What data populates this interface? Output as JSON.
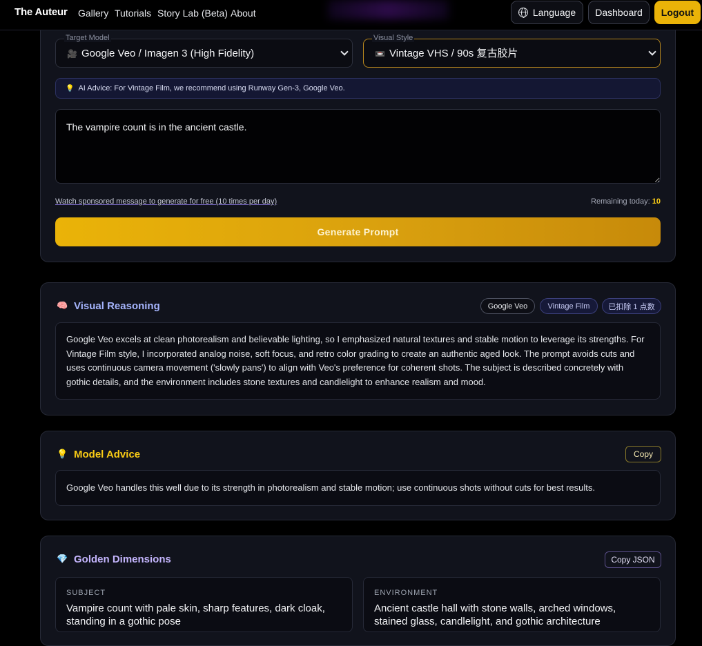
{
  "nav": {
    "brand": "The Auteur",
    "links": [
      "Gallery",
      "Tutorials",
      "Story Lab (Beta)",
      "About"
    ],
    "language_label": "Language",
    "dashboard_label": "Dashboard",
    "logout_label": "Logout"
  },
  "generator": {
    "target_model": {
      "legend": "Target Model",
      "icon": "🎥",
      "selected": "Google Veo / Imagen 3 (High Fidelity)"
    },
    "visual_style": {
      "legend": "Visual Style",
      "icon": "📼",
      "selected": "Vintage VHS / 90s 复古胶片"
    },
    "ai_advice": "AI Advice: For Vintage Film, we recommend using Runway Gen-3, Google Veo.",
    "prompt_text": "The vampire count is in the ancient castle.",
    "sponsored_link": "Watch sponsored message to generate for free (10 times per day)",
    "remaining_label": "Remaining today:",
    "remaining_value": "10",
    "generate_label": "Generate Prompt"
  },
  "visual_reasoning": {
    "icon": "🧠",
    "title": "Visual Reasoning",
    "tags": [
      "Google Veo",
      "Vintage Film",
      "已扣除 1 点数"
    ],
    "body": "Google Veo excels at clean photorealism and believable lighting, so I emphasized natural textures and stable motion to leverage its strengths. For Vintage Film style, I incorporated analog noise, soft focus, and retro color grading to create an authentic aged look. The prompt avoids cuts and uses continuous camera movement ('slowly pans') to align with Veo's preference for coherent shots. The subject is described concretely with gothic details, and the environment includes stone textures and candlelight to enhance realism and mood."
  },
  "model_advice": {
    "icon": "💡",
    "title": "Model Advice",
    "copy_label": "Copy",
    "body": "Google Veo handles this well due to its strength in photorealism and stable motion; use continuous shots without cuts for best results."
  },
  "golden_dimensions": {
    "icon": "💎",
    "title": "Golden Dimensions",
    "copy_label": "Copy JSON",
    "subject_label": "SUBJECT",
    "subject_value": "Vampire count with pale skin, sharp features, dark cloak, standing in a gothic pose",
    "environment_label": "ENVIRONMENT",
    "environment_value": "Ancient castle hall with stone walls, arched windows, stained glass, candlelight, and gothic architecture"
  },
  "colors": {
    "accent_gold": "#eab308",
    "reasoning_title": "#a5b4fc",
    "advice_title": "#facc15",
    "dimensions_title": "#c4b5fd"
  }
}
